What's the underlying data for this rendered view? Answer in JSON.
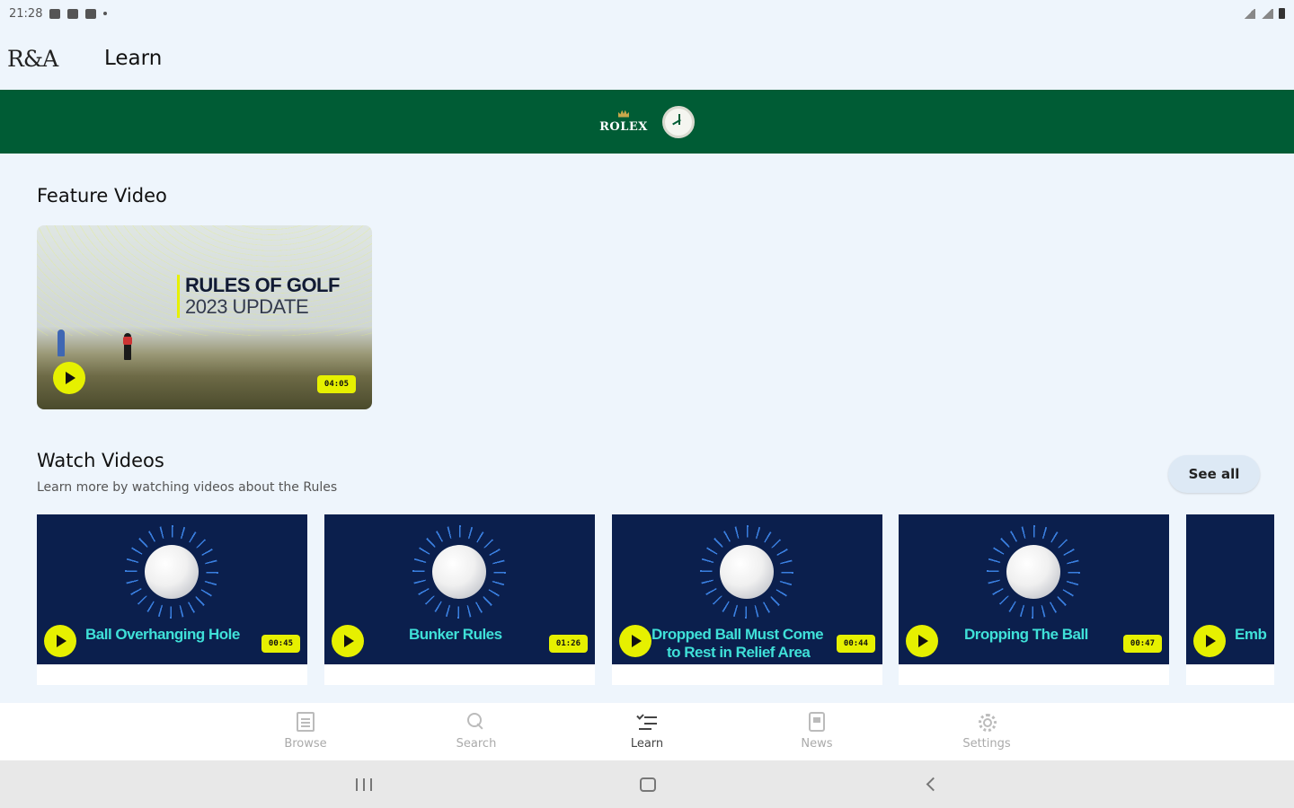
{
  "status_bar": {
    "time": "21:28"
  },
  "app_bar": {
    "logo": "R&A",
    "title": "Learn"
  },
  "sponsor": {
    "brand": "ROLEX"
  },
  "feature": {
    "section_title": "Feature Video",
    "headline_line1": "RULES OF GOLF",
    "headline_line2": "2023 UPDATE",
    "duration": "04:05"
  },
  "watch": {
    "section_title": "Watch Videos",
    "subtitle": "Learn more by watching videos about the Rules",
    "see_all_label": "See all",
    "videos": [
      {
        "title": "Ball Overhanging Hole",
        "duration": "00:45"
      },
      {
        "title": "Bunker Rules",
        "duration": "01:26"
      },
      {
        "title": "Dropped Ball Must Come to Rest in Relief Area",
        "title_line1": "Dropped Ball Must Come",
        "title_line2": "to Rest in Relief Area",
        "duration": "00:44"
      },
      {
        "title": "Dropping The Ball",
        "duration": "00:47"
      },
      {
        "title": "Emb"
      }
    ]
  },
  "bottom_nav": {
    "items": [
      {
        "label": "Browse",
        "icon": "browse-icon"
      },
      {
        "label": "Search",
        "icon": "search-icon"
      },
      {
        "label": "Learn",
        "icon": "learn-icon",
        "active": true
      },
      {
        "label": "News",
        "icon": "news-icon"
      },
      {
        "label": "Settings",
        "icon": "settings-icon"
      }
    ]
  },
  "colors": {
    "brand_green": "#005c35",
    "accent_yellow": "#e6f000",
    "video_bg": "#0b1f4d",
    "video_title": "#3fe0d8"
  }
}
